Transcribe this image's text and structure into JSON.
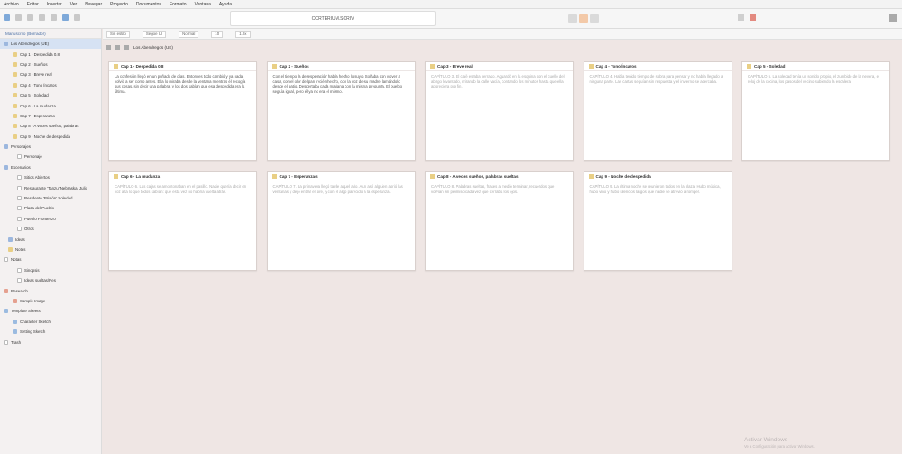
{
  "menu": [
    "Archivo",
    "Editar",
    "Insertar",
    "Ver",
    "Navegar",
    "Proyecto",
    "Documentos",
    "Formato",
    "Ventana",
    "Ayuda"
  ],
  "window_title": "CORTERIUM.SCRIV",
  "binder": {
    "header": "Manuscrito (Borrador)",
    "items": [
      {
        "label": "Los Abendregos (UE)",
        "icon": "folder",
        "selected": true,
        "indent": 0
      },
      {
        "label": "Cap 1 - Despedida 0.8",
        "icon": "doc",
        "indent": 2
      },
      {
        "label": "Cap 2 - Sueños",
        "icon": "doc",
        "indent": 2
      },
      {
        "label": "Cap 3 - Breve real",
        "icon": "doc",
        "indent": 2
      },
      {
        "label": "Cap 4 - Tono Íncaros",
        "icon": "doc",
        "indent": 2
      },
      {
        "label": "Cap 5 - Soledad",
        "icon": "doc",
        "indent": 2
      },
      {
        "label": "Cap 6 - La mudanza",
        "icon": "doc",
        "indent": 2
      },
      {
        "label": "Cap 7 - Esperanzas",
        "icon": "doc",
        "indent": 2
      },
      {
        "label": "Cap 8 - A veces sueños, palabras",
        "icon": "doc",
        "indent": 2
      },
      {
        "label": "Cap 9 - Noche de despedida",
        "icon": "doc",
        "indent": 2
      },
      {
        "label": "Personajes",
        "icon": "folder",
        "indent": 0
      },
      {
        "label": "Personaje",
        "icon": "page",
        "indent": 3
      },
      {
        "label": "Escenarios",
        "icon": "folder",
        "indent": 0
      },
      {
        "label": "Sitios Abiertos",
        "icon": "page",
        "indent": 3
      },
      {
        "label": "Restaurante 'Tanzu' Nebraska, Julio",
        "icon": "page",
        "indent": 3
      },
      {
        "label": "Residente 'Prisión' Soledad",
        "icon": "page",
        "indent": 3
      },
      {
        "label": "Plaza del Pueblo",
        "icon": "page",
        "indent": 3
      },
      {
        "label": "Pueblo Fronterizo",
        "icon": "page",
        "indent": 3
      },
      {
        "label": "Otros",
        "icon": "page",
        "indent": 3
      },
      {
        "label": "Ideas",
        "icon": "folder",
        "indent": 1
      },
      {
        "label": "Notes",
        "icon": "doc",
        "indent": 1
      },
      {
        "label": "Notas",
        "icon": "page",
        "indent": 0
      },
      {
        "label": "Sinopsis",
        "icon": "page",
        "indent": 3
      },
      {
        "label": "Ideas sueltas/Res",
        "icon": "page",
        "indent": 3
      },
      {
        "label": "Research",
        "icon": "red",
        "indent": 0
      },
      {
        "label": "Sample Image",
        "icon": "red",
        "indent": 2
      },
      {
        "label": "Template Sheets",
        "icon": "tmpl",
        "indent": 0
      },
      {
        "label": "Character Sketch",
        "icon": "tmpl",
        "indent": 2
      },
      {
        "label": "Setting Sketch",
        "icon": "tmpl",
        "indent": 2
      },
      {
        "label": "Trash",
        "icon": "page",
        "indent": 0
      }
    ]
  },
  "format": {
    "style": "Sin estilo",
    "font": "Segoe UI",
    "weight": "Normal",
    "size": "10",
    "spacing": "1.0x"
  },
  "path": "Los Abendregos (UE)",
  "cards": [
    {
      "title": "Cap 1 - Despedida 0.8",
      "dim": false,
      "body": "La confesión llegó en un puñado de días. Entonces todo cambió y ya nada volvió a ser como antes. Ella lo miraba desde la ventana mientras él recogía sus cosas, sin decir una palabra, y los dos sabían que esa despedida era la última."
    },
    {
      "title": "Cap 2 - Sueños",
      "dim": false,
      "body": "Con el tiempo la desesperación había hecho lo suyo. Soñaba con volver a casa, con el olor del pan recién hecho, con la voz de su madre llamándolo desde el patio. Despertaba cada mañana con la misma pregunta. El pueblo seguía igual, pero él ya no era el mismo."
    },
    {
      "title": "Cap 3 - Breve real",
      "dim": true,
      "body": "CAPÍTULO 3. El café estaba cerrado. Aguardó en la esquina con el cuello del abrigo levantado, mirando la calle vacía, contando los minutos hasta que ella apareciera por fin."
    },
    {
      "title": "Cap 4 - Tono Íncaros",
      "dim": true,
      "body": "CAPÍTULO 4. Había tenido tiempo de sobra para pensar y no había llegado a ninguna parte. Las cartas seguían sin respuesta y el invierno se acercaba."
    },
    {
      "title": "Cap 5 - Soledad",
      "dim": true,
      "body": "CAPÍTULO 5. La soledad tenía un sonido propio, el zumbido de la nevera, el reloj de la cocina, los pasos del vecino subiendo la escalera."
    },
    {
      "title": "Cap 6 - La mudanza",
      "dim": true,
      "body": "CAPÍTULO 6. Las cajas se amontonaban en el pasillo. Nadie quería decir en voz alta lo que todos sabían: que esta vez no habría vuelta atrás."
    },
    {
      "title": "Cap 7 - Esperanzas",
      "dim": true,
      "body": "CAPÍTULO 7. La primavera llegó tarde aquel año. Aun así, alguien abrió las ventanas y dejó entrar el aire, y con él algo parecido a la esperanza."
    },
    {
      "title": "Cap 8 - A veces sueños, palabras sueltas",
      "dim": true,
      "body": "CAPÍTULO 8. Palabras sueltas, frases a medio terminar, recuerdos que volvían sin permiso cada vez que cerraba los ojos."
    },
    {
      "title": "Cap 9 - Noche de despedida",
      "dim": true,
      "body": "CAPÍTULO 9. La última noche se reunieron todos en la plaza. Hubo música, hubo vino y hubo silencios largos que nadie se atrevió a romper."
    }
  ],
  "activate": {
    "title": "Activar Windows",
    "sub": "Ve a Configuración para activar Windows."
  }
}
